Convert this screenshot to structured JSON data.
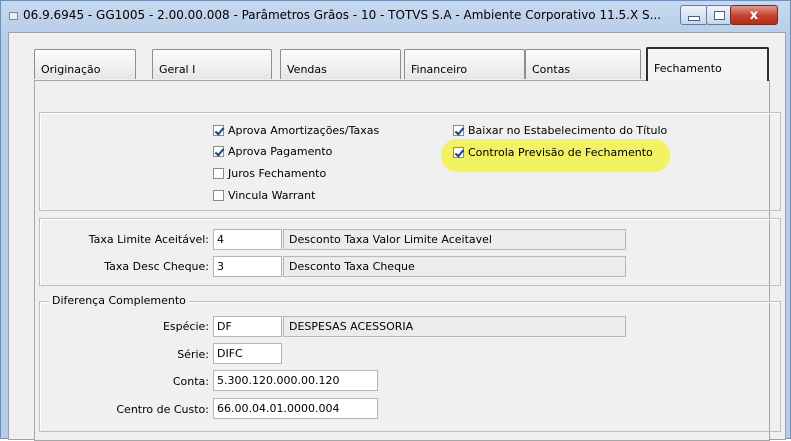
{
  "window": {
    "title": "06.9.6945 - GG1005 - 2.00.00.008 - Parâmetros Grãos - 10 - TOTVS S.A - Ambiente Corporativo 11.5.X S...",
    "close_glyph": "x"
  },
  "tabs": [
    {
      "label": "Originação",
      "selected": false
    },
    {
      "label": "Geral I",
      "selected": false
    },
    {
      "label": "Vendas",
      "selected": false
    },
    {
      "label": "Financeiro",
      "selected": false
    },
    {
      "label": "Contas",
      "selected": false
    },
    {
      "label": "Fechamento",
      "selected": true
    }
  ],
  "options": {
    "aprova_amortizacoes": {
      "label": "Aprova Amortizações/Taxas",
      "checked": true
    },
    "aprova_pagamento": {
      "label": "Aprova Pagamento",
      "checked": true
    },
    "juros_fechamento": {
      "label": "Juros Fechamento",
      "checked": false
    },
    "vincula_warrant": {
      "label": "Vincula Warrant",
      "checked": false
    },
    "baixar_estabelecimento": {
      "label": "Baixar no Estabelecimento do Título",
      "checked": true
    },
    "controla_previsao": {
      "label": "Controla Previsão de Fechamento",
      "checked": true,
      "highlight_color": "#f2f24a"
    }
  },
  "taxas": {
    "limite_label": "Taxa Limite Aceitável:",
    "limite_value": "4",
    "limite_desc": "Desconto Taxa Valor Limite Aceitavel",
    "cheque_label": "Taxa Desc Cheque:",
    "cheque_value": "3",
    "cheque_desc": "Desconto Taxa Cheque"
  },
  "diferenca": {
    "legend": "Diferença Complemento",
    "especie_label": "Espécie:",
    "especie_value": "DF",
    "especie_desc": "DESPESAS ACESSORIA",
    "serie_label": "Série:",
    "serie_value": "DIFC",
    "conta_label": "Conta:",
    "conta_value": "5.300.120.000.00.120",
    "centro_label": "Centro de Custo:",
    "centro_value": "66.00.04.01.0000.004"
  }
}
